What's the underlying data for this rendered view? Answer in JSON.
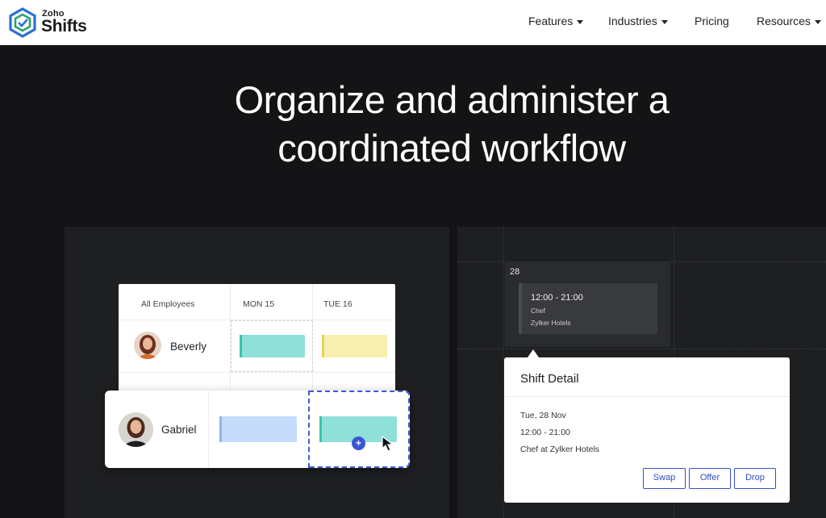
{
  "header": {
    "logo": {
      "top": "Zoho",
      "bottom": "Shifts"
    },
    "nav": [
      {
        "label": "Features",
        "dropdown": true
      },
      {
        "label": "Industries",
        "dropdown": true
      },
      {
        "label": "Pricing",
        "dropdown": false
      },
      {
        "label": "Resources",
        "dropdown": true
      }
    ]
  },
  "hero": {
    "line1": "Organize and administer a",
    "line2": "coordinated workflow"
  },
  "schedule": {
    "columns": [
      "All Employees",
      "MON 15",
      "TUE 16"
    ],
    "rows": [
      {
        "name": "Beverly"
      },
      {
        "name": "Gabriel"
      }
    ],
    "add_icon": "+"
  },
  "calendar": {
    "day": "28",
    "shift": {
      "time": "12:00 - 21:00",
      "role": "Chef",
      "location": "Zylker Hotels"
    }
  },
  "shift_detail": {
    "title": "Shift Detail",
    "date": "Tue, 28 Nov",
    "time": "12:00 - 21:00",
    "role_line": "Chef at Zylker Hotels",
    "buttons": {
      "swap": "Swap",
      "offer": "Offer",
      "drop": "Drop"
    }
  },
  "colors": {
    "background": "#141416",
    "panel": "#1e1f21",
    "teal_bar": "#8ee0d8",
    "yellow_bar": "#f8eeae",
    "blue_bar": "#c6dcfb",
    "accent": "#3a54d6"
  }
}
